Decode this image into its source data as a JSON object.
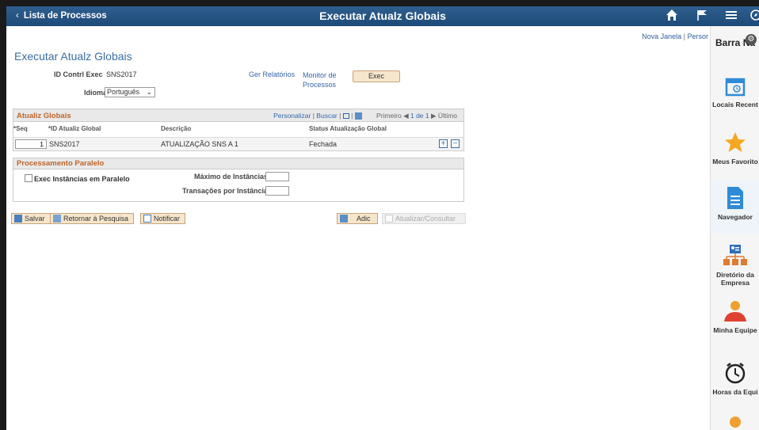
{
  "header": {
    "back_label": "Lista de Processos",
    "title": "Executar Atualz Globais",
    "icons": [
      "home-icon",
      "flag-icon",
      "menu-icon",
      "compass-icon"
    ]
  },
  "top_links": {
    "new_window": "Nova Janela",
    "personalize": "Persor"
  },
  "page_title": "Executar Atualz Globais",
  "form": {
    "run_control_label": "ID Contrl Exec",
    "run_control_value": "SNS2017",
    "language_label": "Idioma",
    "language_value": "Português",
    "report_manager": "Ger Relatórios",
    "process_monitor": "Monitor de Processos",
    "exec_button": "Exec"
  },
  "grid": {
    "title": "Atualiz Globais",
    "nav": {
      "personalize": "Personalizar",
      "find": "Buscar",
      "first": "Primeiro",
      "range": "1 de 1",
      "last": "Último"
    },
    "columns": [
      "*Seq",
      "*ID Atualiz Global",
      "Descrição",
      "Status Atualização Global"
    ],
    "rows": [
      {
        "seq": "1",
        "id": "SNS2017",
        "description": "ATUALIZAÇÃO SNS A 1",
        "status": "Fechada"
      }
    ]
  },
  "parallel": {
    "title": "Processamento Paralelo",
    "checkbox_label": "Exec Instâncias em Paralelo",
    "max_instances_label": "Máximo de Instâncias",
    "tx_per_instance_label": "Transações por Instância"
  },
  "buttons": {
    "save": "Salvar",
    "return_search": "Retornar à Pesquisa",
    "notify": "Notificar",
    "add": "Adic",
    "update_display": "Atualizar/Consultar"
  },
  "right_panel": {
    "title": "Barra Na",
    "tiles": [
      {
        "label": "Locais Recent",
        "icon": "calendar-icon"
      },
      {
        "label": "Meus Favorito",
        "icon": "star-icon"
      },
      {
        "label": "Navegador",
        "icon": "document-icon"
      },
      {
        "label": "Diretório da Empresa",
        "icon": "org-chart-icon"
      },
      {
        "label": "Minha Equipe",
        "icon": "team-icon"
      },
      {
        "label": "Horas da Equi",
        "icon": "clock-icon"
      }
    ]
  },
  "colors": {
    "header": "#1d4a78",
    "accent": "#c0652a",
    "link": "#3366aa",
    "star": "#f5a623"
  }
}
